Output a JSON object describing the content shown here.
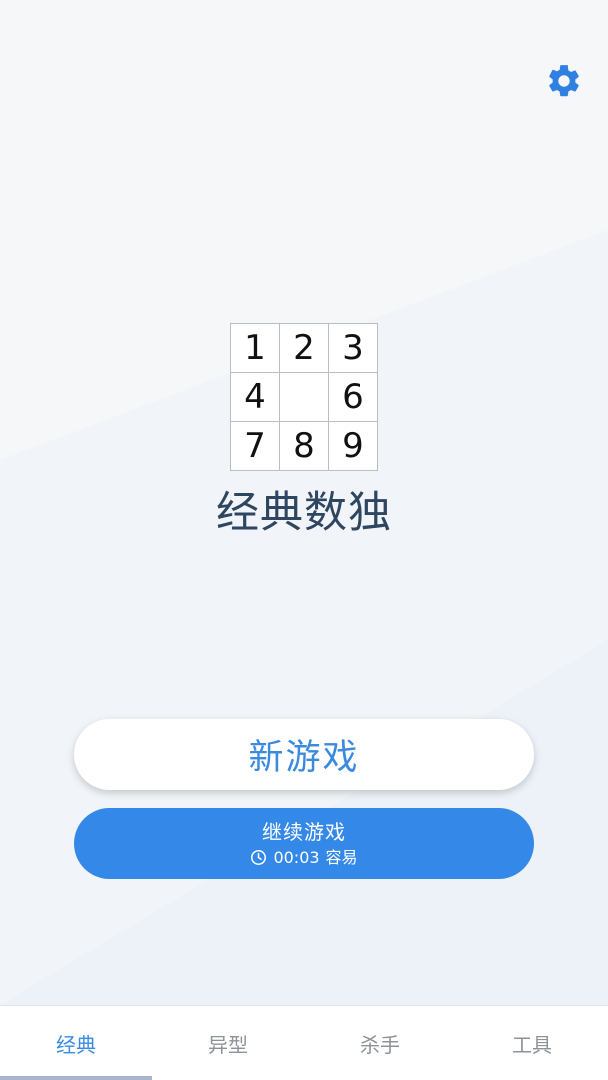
{
  "header": {
    "settings_icon": "gear-icon",
    "settings_color": "#2f80e0"
  },
  "logo": {
    "cells": [
      "1",
      "2",
      "3",
      "4",
      "",
      "6",
      "7",
      "8",
      "9"
    ]
  },
  "app_title": "经典数独",
  "actions": {
    "new_game_label": "新游戏",
    "continue_label": "继续游戏",
    "continue_time": "00:03",
    "continue_difficulty": "容易",
    "continue_icon": "clock-icon"
  },
  "tabs": [
    {
      "label": "经典",
      "active": true
    },
    {
      "label": "异型",
      "active": false
    },
    {
      "label": "杀手",
      "active": false
    },
    {
      "label": "工具",
      "active": false
    }
  ],
  "colors": {
    "accent": "#3388e8",
    "title": "#2e4660",
    "background": "#f3f5f8"
  }
}
